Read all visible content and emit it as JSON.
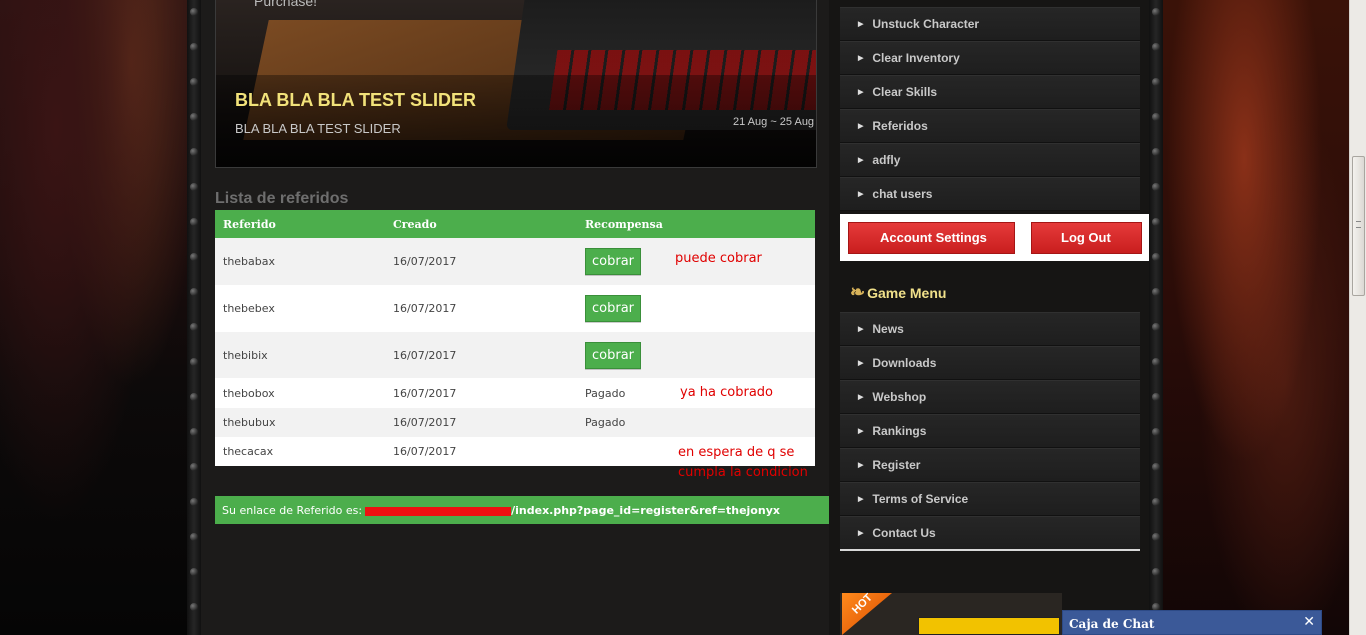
{
  "slider": {
    "purchase_text": "Purchase!",
    "title": "BLA BLA BLA TEST SLIDER",
    "subtitle": "BLA BLA BLA TEST SLIDER",
    "date_range": "21 Aug ~ 25 Aug"
  },
  "referrals": {
    "section_title": "Lista de referidos",
    "columns": [
      "Referido",
      "Creado",
      "Recompensa"
    ],
    "rows": [
      {
        "name": "thebabax",
        "created": "16/07/2017",
        "reward": "cobrar",
        "reward_type": "button"
      },
      {
        "name": "thebebex",
        "created": "16/07/2017",
        "reward": "cobrar",
        "reward_type": "button"
      },
      {
        "name": "thebibix",
        "created": "16/07/2017",
        "reward": "cobrar",
        "reward_type": "button"
      },
      {
        "name": "thebobox",
        "created": "16/07/2017",
        "reward": "Pagado",
        "reward_type": "text"
      },
      {
        "name": "thebubux",
        "created": "16/07/2017",
        "reward": "Pagado",
        "reward_type": "text"
      },
      {
        "name": "thecacax",
        "created": "16/07/2017",
        "reward": "",
        "reward_type": "text"
      }
    ],
    "annotations": {
      "can_claim": "puede cobrar",
      "already_claimed": "ya ha cobrado",
      "waiting_line1": "en espera de q se",
      "waiting_line2": "cumpla la condicion"
    }
  },
  "referral_link": {
    "label": "Su enlace de Referido es:",
    "url_suffix": "/index.php?page_id=register&ref=thejonyx"
  },
  "user_menu": {
    "items": [
      "Unstuck Character",
      "Clear Inventory",
      "Clear Skills",
      "Referidos",
      "adfly",
      "chat users"
    ],
    "account_settings_label": "Account Settings",
    "logout_label": "Log Out"
  },
  "game_menu": {
    "title": "Game Menu",
    "items": [
      "News",
      "Downloads",
      "Webshop",
      "Rankings",
      "Register",
      "Terms of Service",
      "Contact Us"
    ]
  },
  "hot_badge": "HOT",
  "chat": {
    "title": "Caja de Chat",
    "close_symbol": "✕"
  },
  "colors": {
    "accent_green": "#4cae4c",
    "account_red": "#e53a3a",
    "chat_blue": "#3b5998",
    "note_red": "#e00000"
  }
}
